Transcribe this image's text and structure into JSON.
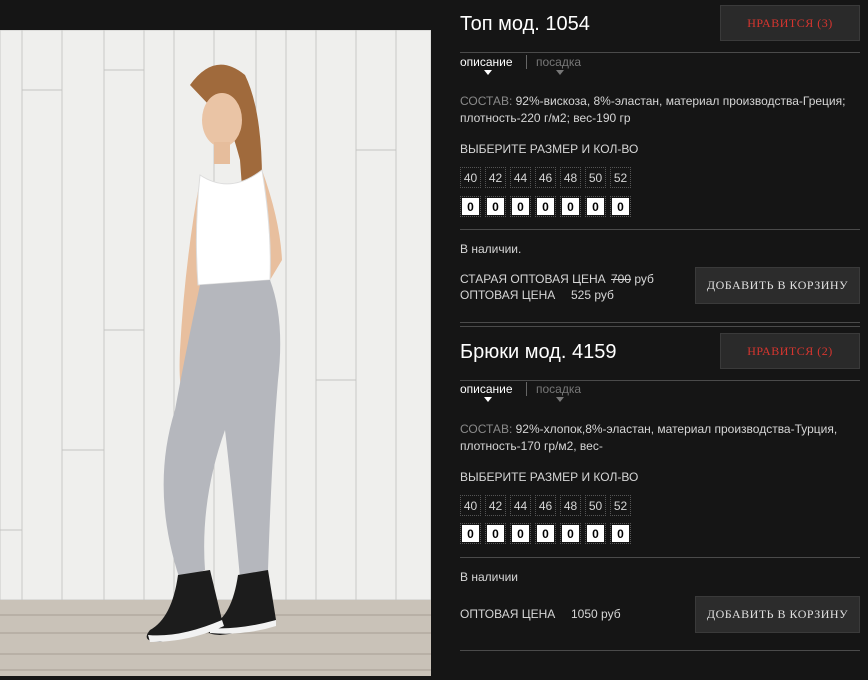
{
  "products": [
    {
      "title": "Топ мод. 1054",
      "like_label": "НРАВИТСЯ (3)",
      "tabs": [
        "описание",
        "посадка"
      ],
      "composition_label": "СОСТАВ:",
      "composition_text": "92%-вискоза, 8%-эластан, материал производства-Греция; плотность-220 г/м2; вес-190 гр",
      "choose_label": "ВЫБЕРИТЕ РАЗМЕР И КОЛ-ВО",
      "sizes": [
        "40",
        "42",
        "44",
        "46",
        "48",
        "50",
        "52"
      ],
      "quantities": [
        "0",
        "0",
        "0",
        "0",
        "0",
        "0",
        "0"
      ],
      "stock": "В наличии.",
      "old_price_label": "СТАРАЯ ОПТОВАЯ ЦЕНА",
      "old_price_value": "700",
      "old_price_currency": "руб",
      "price_label": "ОПТОВАЯ ЦЕНА",
      "price_value": "525 руб",
      "cart_label": "ДОБАВИТЬ В КОРЗИНУ"
    },
    {
      "title": "Брюки мод. 4159",
      "like_label": "НРАВИТСЯ (2)",
      "tabs": [
        "описание",
        "посадка"
      ],
      "composition_label": "СОСТАВ:",
      "composition_text": "92%-хлопок,8%-эластан, материал производства-Турция, плотность-170 гр/м2, вес-",
      "choose_label": "ВЫБЕРИТЕ РАЗМЕР И КОЛ-ВО",
      "sizes": [
        "40",
        "42",
        "44",
        "46",
        "48",
        "50",
        "52"
      ],
      "quantities": [
        "0",
        "0",
        "0",
        "0",
        "0",
        "0",
        "0"
      ],
      "stock": "В наличии",
      "price_label": "ОПТОВАЯ ЦЕНА",
      "price_value": "1050 руб",
      "cart_label": "ДОБАВИТЬ В КОРЗИНУ"
    }
  ],
  "colors": {
    "background": "#151515",
    "like_text": "#d7352f",
    "button_bg": "#2c2c2c"
  }
}
